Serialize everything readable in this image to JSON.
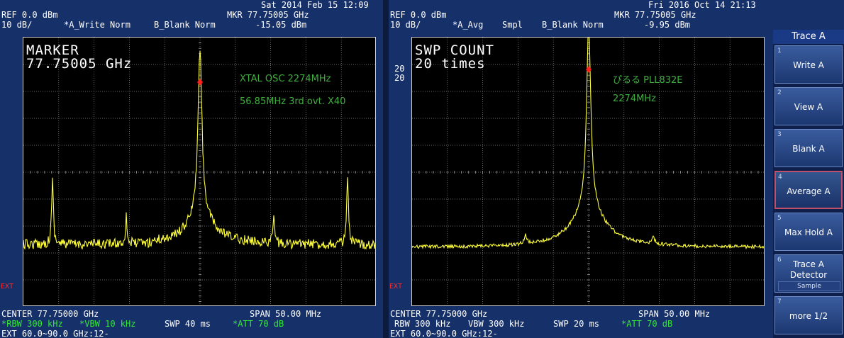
{
  "left": {
    "datetime": "Sat 2014 Feb 15 12:09",
    "ref": "REF 0.0 dBm",
    "scale": "10 dB/",
    "trace_a": "*A_Write Norm",
    "trace_b": "B_Blank Norm",
    "mkr_freq": "MKR 77.75005 GHz",
    "mkr_level": "-15.05 dBm",
    "big_line1": "MARKER",
    "big_line2": "77.75005 GHz",
    "anno1": "XTAL OSC 2274MHz",
    "anno2": "56.85MHz 3rd ovt. X40",
    "ext": "EXT",
    "center": "CENTER 77.75000 GHz",
    "span": "SPAN 50.00 MHz",
    "rbw": "*RBW 300 kHz",
    "vbw": "*VBW 10 kHz",
    "swp": "SWP 40 ms",
    "att": "*ATT 70 dB",
    "ext_range": "EXT 60.0~90.0 GHz:12-"
  },
  "right": {
    "datetime": "Fri 2016 Oct 14 21:13",
    "ref": "REF 0.0 dBm",
    "scale": "10 dB/",
    "trace_a": "*A_Avg",
    "smpl": "Smpl",
    "trace_b": "B_Blank Norm",
    "mkr_freq": "MKR 77.75005 GHz",
    "mkr_level": "-9.95 dBm",
    "big_line1": "SWP COUNT",
    "big_line2": "20 times",
    "avg_count_top": "20",
    "avg_count_bottom": "20",
    "anno1": "ぴるる PLL832E",
    "anno2": "2274MHz",
    "ext": "EXT",
    "center": "CENTER 77.75000 GHz",
    "span": "SPAN 50.00 MHz",
    "rbw": "RBW 300 kHz",
    "vbw": "VBW 300 kHz",
    "swp": "SWP 20 ms",
    "att": "*ATT 70 dB",
    "ext_range": "EXT 60.0~90.0 GHz:12-"
  },
  "softkeys": {
    "title": "Trace A",
    "items": [
      {
        "num": "1",
        "label": "Write A"
      },
      {
        "num": "2",
        "label": "View A"
      },
      {
        "num": "3",
        "label": "Blank A"
      },
      {
        "num": "4",
        "label": "Average A"
      },
      {
        "num": "5",
        "label": "Max Hold A"
      },
      {
        "num": "6",
        "label1": "Trace A",
        "label2": "Detector",
        "sub": "Sample"
      },
      {
        "num": "7",
        "label": "more 1/2"
      }
    ]
  },
  "colors": {
    "background": "#16306a",
    "trace": "#ffff3a",
    "marker": "#ff2020",
    "annotation": "#3fae3f",
    "status_green": "#35e835",
    "active_key_border": "#c0506a"
  }
}
